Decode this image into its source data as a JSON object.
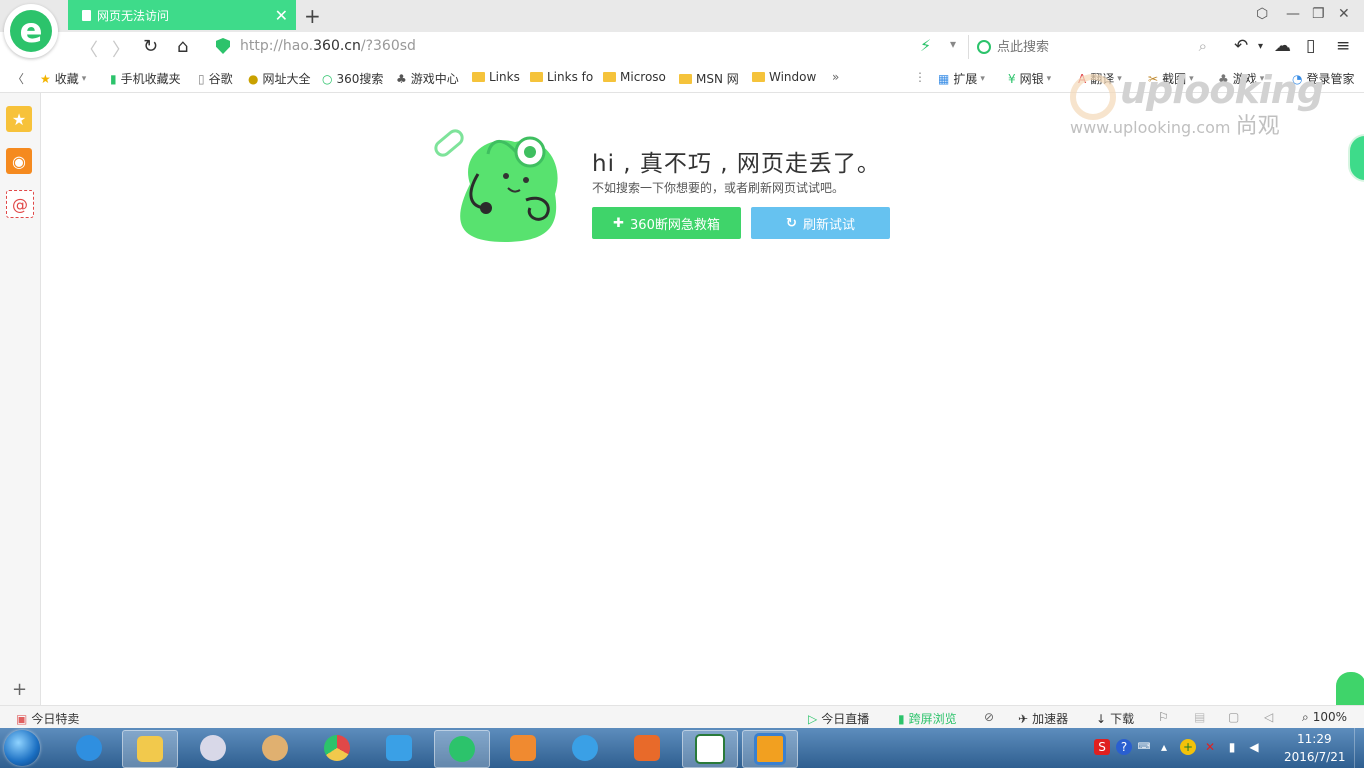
{
  "tab": {
    "title": "网页无法访问"
  },
  "address_bar": {
    "url_prefix": "http://hao.",
    "url_domain": "360.cn",
    "url_suffix": "/?360sd"
  },
  "search": {
    "placeholder": "点此搜索"
  },
  "bookmarks": {
    "favorites": "收藏",
    "items": [
      "手机收藏夹",
      "谷歌",
      "网址大全",
      "360搜索",
      "游戏中心",
      "Links",
      "Links fo",
      "Microso",
      "MSN 网",
      "Window"
    ],
    "more": "»",
    "right_items": [
      "扩展",
      "网银",
      "翻译",
      "截图",
      "游戏",
      "登录管家"
    ]
  },
  "error_page": {
    "title": "hi , 真不巧 , 网页走丢了。",
    "subtitle": "不如搜索一下你想要的，或者刷新网页试试吧。",
    "rescue_button": "360断网急救箱",
    "refresh_button": "刷新试试"
  },
  "watermark": {
    "brand": "uplooking",
    "site": "www.uplooking.com",
    "cn": "尚观"
  },
  "statusbar": {
    "left": "今日特卖",
    "live": "今日直播",
    "cross_screen": "跨屏浏览",
    "accelerator": "加速器",
    "download": "下载",
    "zoom": "100%"
  },
  "taskbar": {
    "time": "11:29",
    "date": "2016/7/21"
  },
  "colors": {
    "accent_green": "#3edb8a",
    "button_green": "#3fd46a",
    "button_blue": "#66c2f0"
  }
}
